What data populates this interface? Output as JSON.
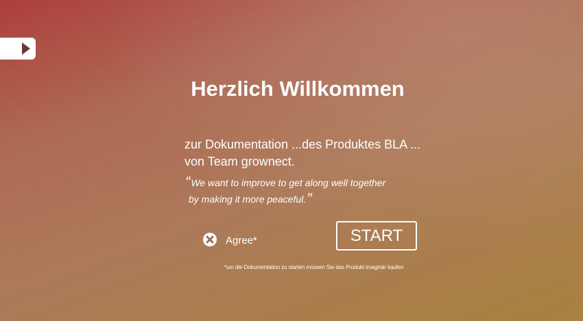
{
  "side_toggle": {
    "icon": "play-arrow-icon"
  },
  "welcome": {
    "title": "Herzlich Willkommen",
    "subtitle_line1": "zur Dokumentation ...des Produktes BLA ...",
    "subtitle_line2": "von Team grownect."
  },
  "quote": {
    "open_mark": "“",
    "line1": "We want to improve to get along well together",
    "line2": "by making it more peaceful.",
    "close_mark": "”"
  },
  "agree": {
    "label": "Agree*",
    "icon": "x-circle-icon"
  },
  "start_button": {
    "label": "START"
  },
  "footnote": "*um die Dokumentation zu starten müssen Sie das Produkt imaginär kaufen",
  "colors": {
    "gradient_start": "#ad3f3a",
    "gradient_mid": "#ad7a5a",
    "gradient_end": "#a8823f",
    "text": "#ffffff"
  }
}
